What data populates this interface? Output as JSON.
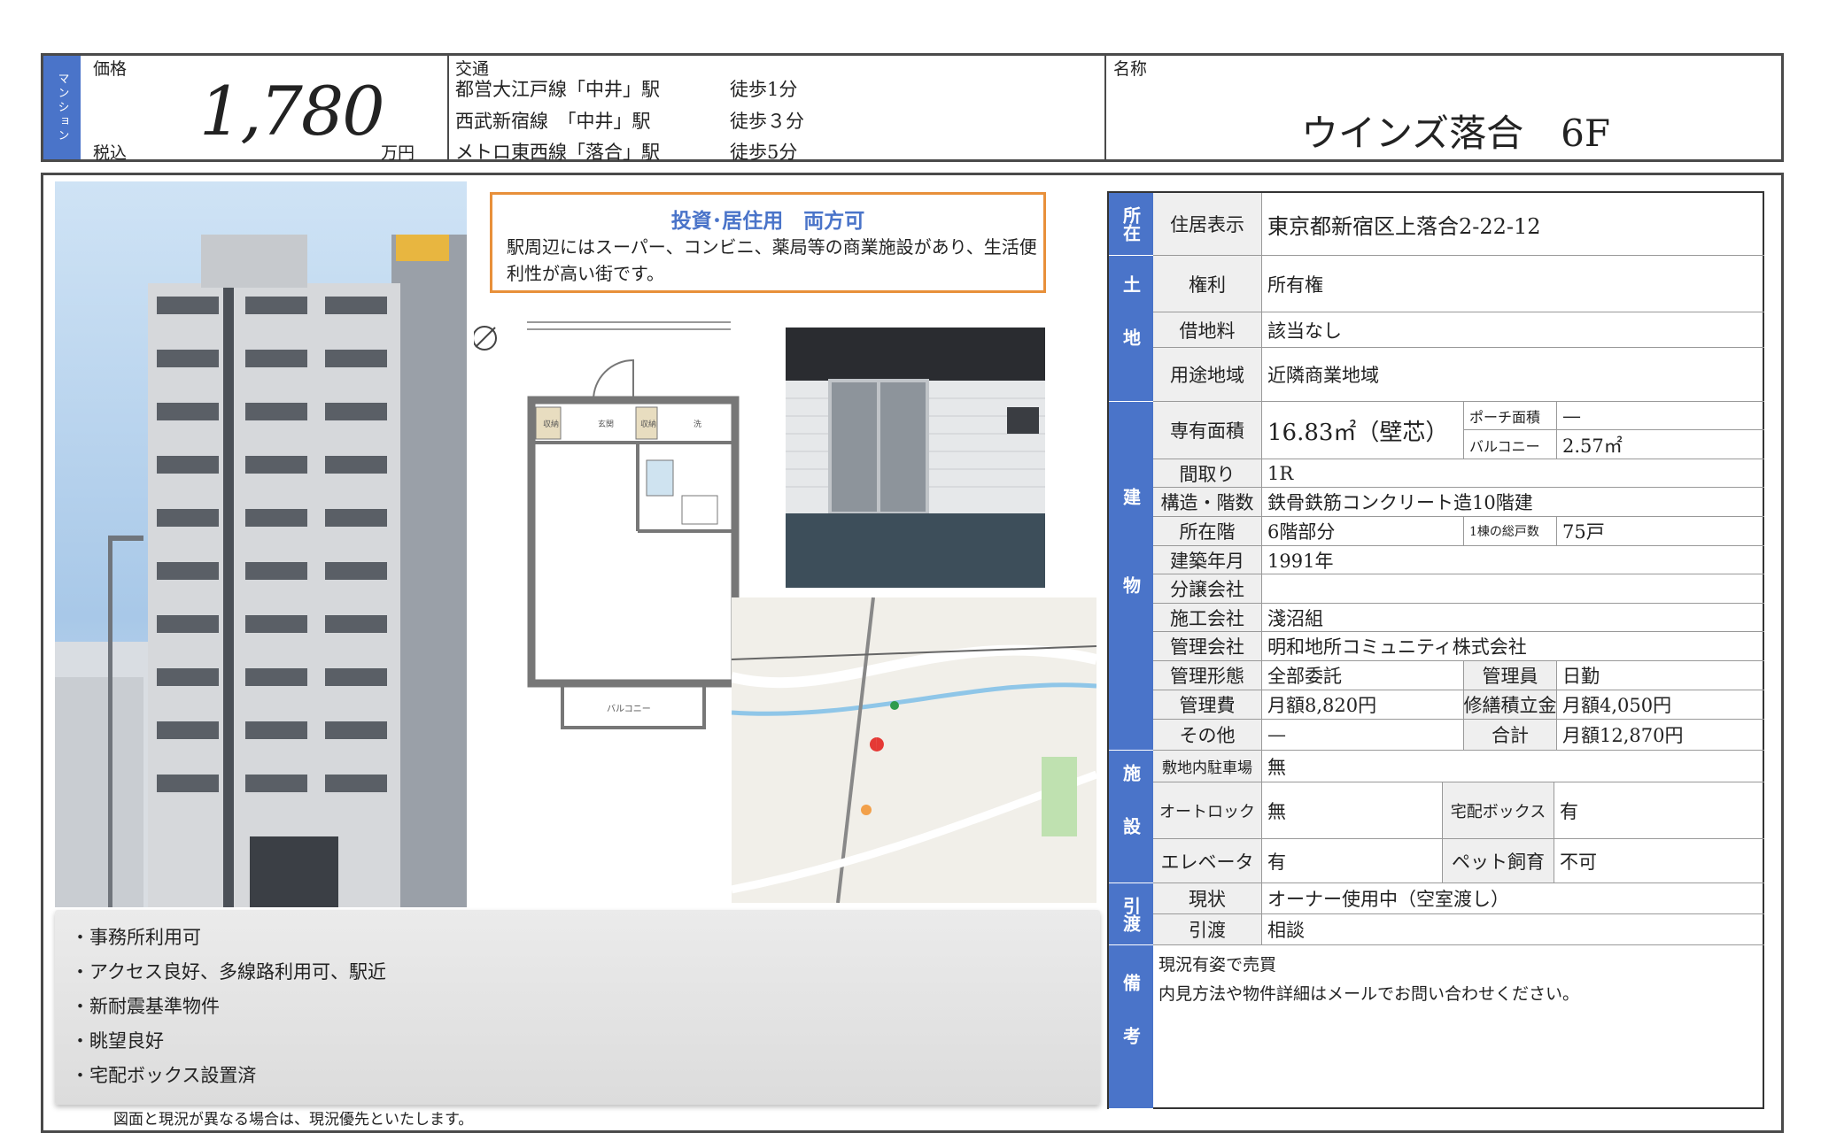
{
  "header": {
    "category": "マンション",
    "price_label": "価格",
    "price": "1,780",
    "tax_label": "税込",
    "unit": "万円",
    "transport_label": "交通",
    "transport": [
      {
        "line": "都営大江戸線「中井」駅",
        "walk": "徒歩1分"
      },
      {
        "line": "西武新宿線　「中井」駅",
        "walk": "徒歩３分"
      },
      {
        "line": "メトロ東西線「落合」駅",
        "walk": "徒歩5分"
      }
    ],
    "name_label": "名称",
    "property_name": "ウインズ落合　6F"
  },
  "callout": {
    "title": "投資･居住用　両方可",
    "body": "駅周辺にはスーパー、コンビニ、薬局等の商業施設があり、生活便利性が高い街です。"
  },
  "floorplan": {
    "labels": [
      "収納",
      "玄関",
      "収納",
      "洗",
      "バルコニー"
    ]
  },
  "features": [
    "・事務所利用可",
    "・アクセス良好、多線路利用可、駅近",
    "・新耐震基準物件",
    "・眺望良好",
    "・宅配ボックス設置済"
  ],
  "note": "図面と現況が異なる場合は、現況優先といたします。",
  "details": {
    "sections": {
      "location": "所在",
      "land": "土地",
      "building": "建物",
      "facilities": "施設",
      "handover": "引渡",
      "remarks": "備考"
    },
    "address_label": "住居表示",
    "address": "東京都新宿区上落合2-22-12",
    "rights_label": "権利",
    "rights": "所有権",
    "lease_label": "借地料",
    "lease": "該当なし",
    "zoning_label": "用途地域",
    "zoning": "近隣商業地域",
    "area_label": "専有面積",
    "area": "16.83㎡（壁芯）",
    "porch_label": "ポーチ面積",
    "porch": "—",
    "balcony_label": "バルコニー",
    "balcony": "2.57㎡",
    "layout_label": "間取り",
    "layout": "1R",
    "structure_label": "構造・階数",
    "structure": "鉄骨鉄筋コンクリート造10階建",
    "floor_label": "所在階",
    "floor": "6階部分",
    "units_label": "1棟の総戸数",
    "units": "75戸",
    "built_label": "建築年月",
    "built": "1991年",
    "seller_label": "分譲会社",
    "seller": "",
    "builder_label": "施工会社",
    "builder": "淺沼組",
    "mgmt_co_label": "管理会社",
    "mgmt_co": "明和地所コミュニティ株式会社",
    "mgmt_form_label": "管理形態",
    "mgmt_form": "全部委託",
    "manager_label": "管理員",
    "manager": "日勤",
    "mgmt_fee_label": "管理費",
    "mgmt_fee": "月額8,820円",
    "repair_label": "修繕積立金",
    "repair": "月額4,050円",
    "other_label": "その他",
    "other": "—",
    "total_label": "合計",
    "total": "月額12,870円",
    "parking_label": "敷地内駐車場",
    "parking": "無",
    "autolock_label": "オートロック",
    "autolock": "無",
    "delivery_label": "宅配ボックス",
    "delivery": "有",
    "elevator_label": "エレベータ",
    "elevator": "有",
    "pet_label": "ペット飼育",
    "pet": "不可",
    "status_label": "現状",
    "status": "オーナー使用中（空室渡し）",
    "handover_label": "引渡",
    "handover": "相談",
    "remarks": [
      "現況有姿で売買",
      "内見方法や物件詳細はメールでお問い合わせください。"
    ]
  },
  "colors": {
    "section_blue": "#4a74c9",
    "callout_border": "#e8903a",
    "frame": "#4a4a4a"
  }
}
